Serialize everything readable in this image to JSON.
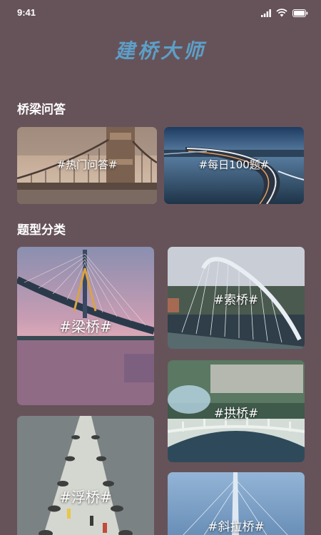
{
  "status": {
    "time": "9:41"
  },
  "app": {
    "title": "建桥大师"
  },
  "qa_section": {
    "title": "桥梁问答",
    "cards": [
      {
        "label": "#热门问答#"
      },
      {
        "label": "#每日100题#"
      }
    ]
  },
  "category_section": {
    "title": "题型分类",
    "cards": [
      {
        "label": "#梁桥#"
      },
      {
        "label": "#索桥#"
      },
      {
        "label": "#拱桥#"
      },
      {
        "label": "#浮桥#"
      },
      {
        "label": "#斜拉桥#"
      }
    ]
  }
}
